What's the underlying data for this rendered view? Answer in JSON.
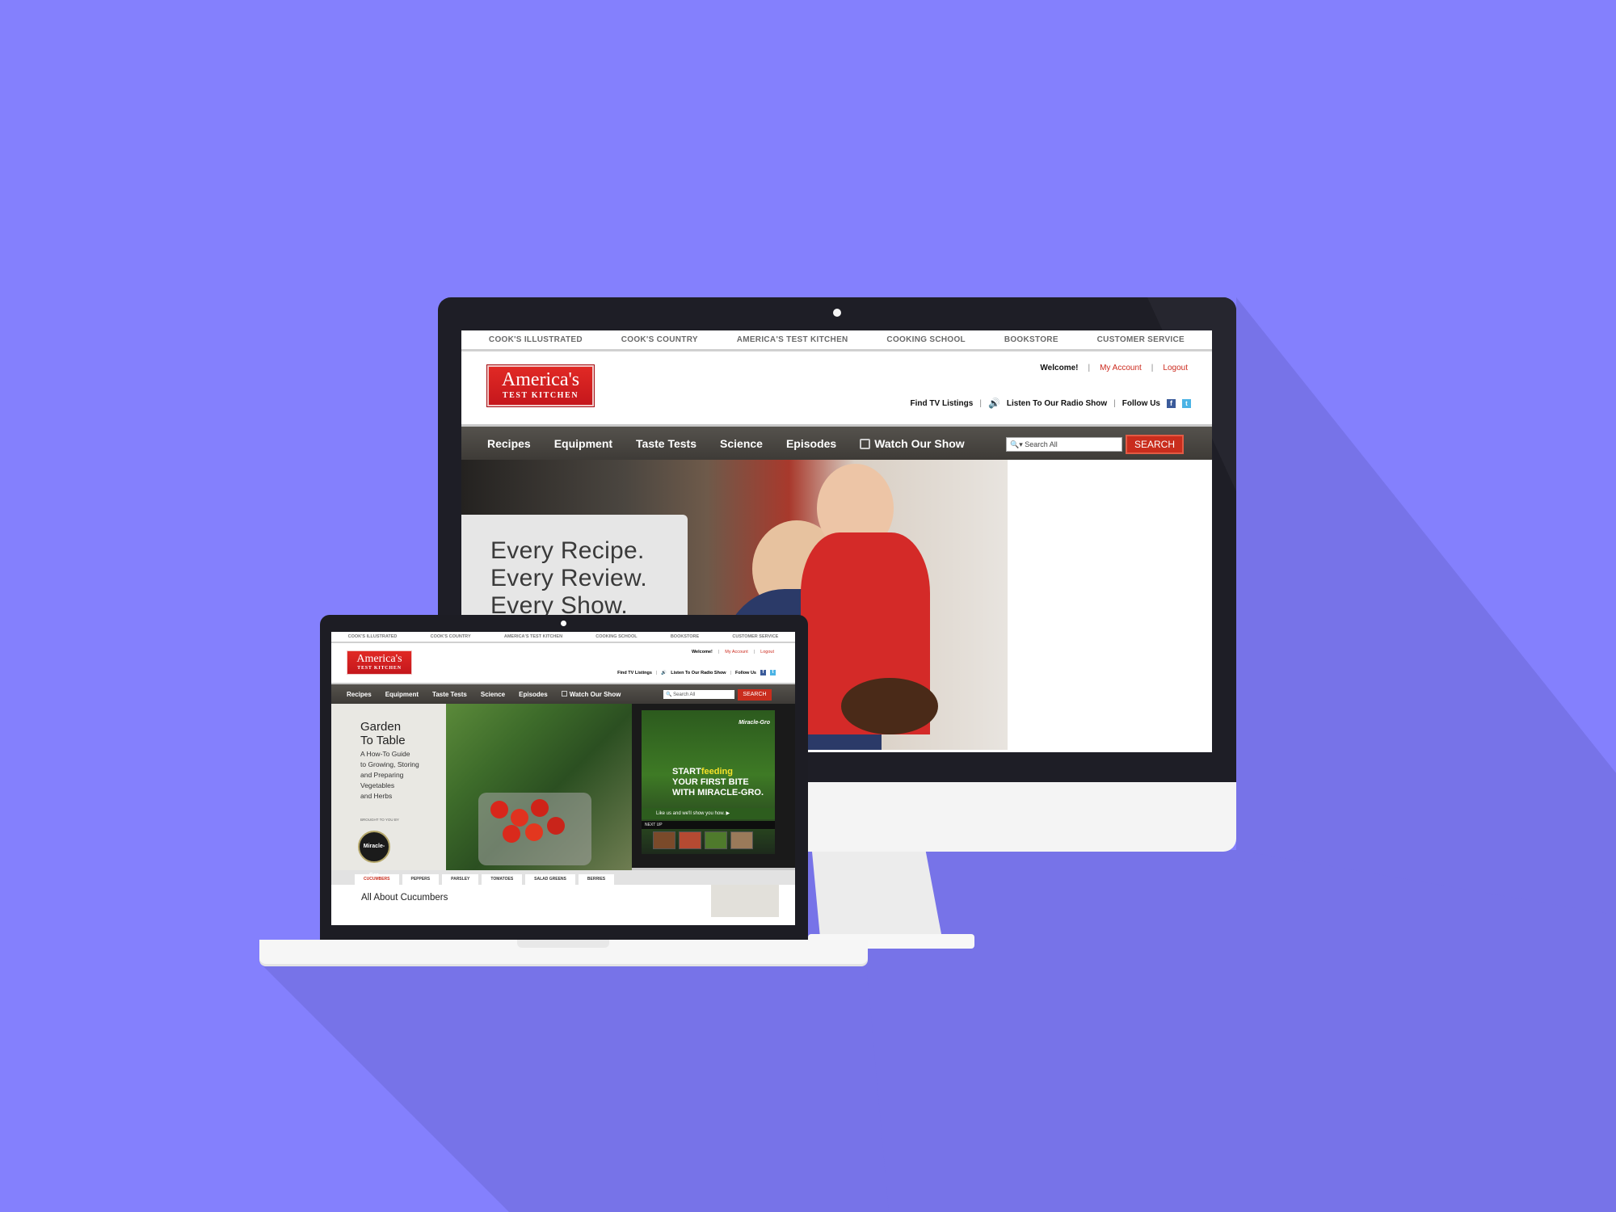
{
  "site": {
    "top_links": [
      "COOK'S ILLUSTRATED",
      "COOK'S COUNTRY",
      "AMERICA'S TEST KITCHEN",
      "COOKING SCHOOL",
      "BOOKSTORE",
      "CUSTOMER SERVICE"
    ],
    "logo": {
      "line1": "America's",
      "line2": "TEST KITCHEN"
    },
    "user": {
      "welcome": "Welcome!",
      "account": "My Account",
      "logout": "Logout",
      "separator": "|"
    },
    "utility": {
      "tv": "Find TV Listings",
      "radio": "Listen To Our Radio Show",
      "follow": "Follow Us",
      "facebook_glyph": "f",
      "twitter_glyph": "t"
    },
    "main_nav": [
      "Recipes",
      "Equipment",
      "Taste Tests",
      "Science",
      "Episodes",
      "Watch Our Show"
    ],
    "search": {
      "placeholder": "Search All",
      "button": "SEARCH"
    }
  },
  "desktop_hero": {
    "lines": [
      "Every Recipe.",
      "Every Review.",
      "Every Show."
    ]
  },
  "laptop_page": {
    "feature": {
      "title": [
        "Garden",
        "To Table"
      ],
      "subtitle": [
        "A How-To Guide",
        "to Growing, Storing",
        "and Preparing",
        "Vegetables",
        "and Herbs"
      ],
      "brought": "BROUGHT TO YOU BY",
      "sponsor": "Miracle-Gro"
    },
    "ad": {
      "brand": "Miracle-Gro",
      "line1a": "START",
      "line1b": "feeding",
      "line2": "YOUR FIRST BITE",
      "line3": "WITH MIRACLE-GRO.",
      "cta": "Like us and we'll show you how. ▶",
      "next_up": "NEXT UP"
    },
    "tabs": [
      "CUCUMBERS",
      "PEPPERS",
      "PARSLEY",
      "TOMATOES",
      "SALAD GREENS",
      "BERRIES"
    ],
    "section_heading": "All About Cucumbers"
  },
  "colors": {
    "background": "#8480fd",
    "brand_red": "#c92d1d",
    "nav_dark": "#4a4743"
  }
}
